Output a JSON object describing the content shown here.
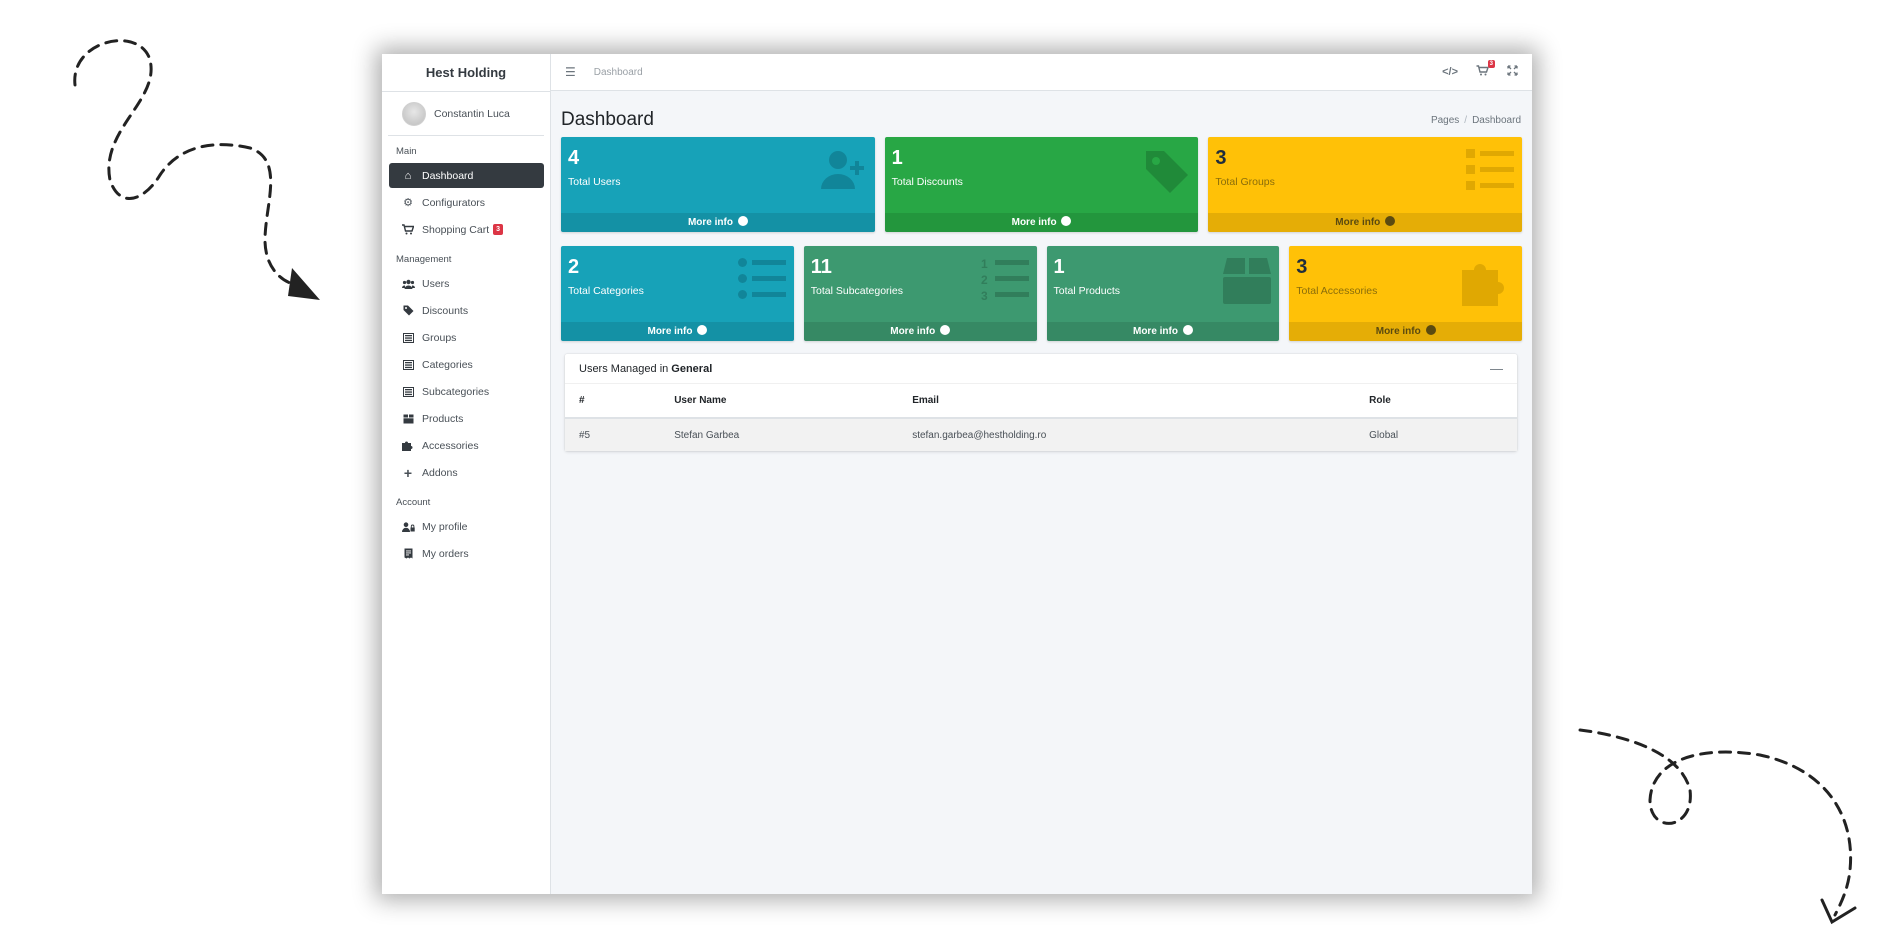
{
  "brand": "Hest Holding",
  "user": {
    "name": "Constantin Luca"
  },
  "sidebar": {
    "sections": [
      {
        "header": "Main",
        "items": [
          {
            "label": "Dashboard",
            "icon": "home-icon",
            "active": true
          },
          {
            "label": "Configurators",
            "icon": "gear-icon"
          },
          {
            "label": "Shopping Cart",
            "icon": "cart-icon",
            "badge": "3"
          }
        ]
      },
      {
        "header": "Management",
        "items": [
          {
            "label": "Users",
            "icon": "users-icon"
          },
          {
            "label": "Discounts",
            "icon": "tag-icon"
          },
          {
            "label": "Groups",
            "icon": "list-icon"
          },
          {
            "label": "Categories",
            "icon": "list-icon"
          },
          {
            "label": "Subcategories",
            "icon": "list-icon"
          },
          {
            "label": "Products",
            "icon": "box-icon"
          },
          {
            "label": "Accessories",
            "icon": "puzzle-icon"
          },
          {
            "label": "Addons",
            "icon": "plus-icon"
          }
        ]
      },
      {
        "header": "Account",
        "items": [
          {
            "label": "My profile",
            "icon": "user-lock-icon"
          },
          {
            "label": "My orders",
            "icon": "receipt-icon"
          }
        ]
      }
    ]
  },
  "topbar": {
    "link": "Dashboard",
    "cart_badge": "3"
  },
  "page": {
    "title": "Dashboard",
    "breadcrumb": [
      "Pages",
      "Dashboard"
    ]
  },
  "stats": [
    {
      "number": "4",
      "label": "Total Users",
      "color": "#17a2b8",
      "icon": "user-plus-icon",
      "footer": "More info"
    },
    {
      "number": "1",
      "label": "Total Discounts",
      "color": "#28a745",
      "icon": "tag-icon",
      "footer": "More info"
    },
    {
      "number": "3",
      "label": "Total Groups",
      "color": "#ffc107",
      "icon": "list-icon",
      "footer": "More info"
    },
    {
      "number": "2",
      "label": "Total Categories",
      "color": "#17a2b8",
      "icon": "list-ul-icon",
      "footer": "More info"
    },
    {
      "number": "11",
      "label": "Total Subcategories",
      "color": "#3d9970",
      "icon": "list-ol-icon",
      "footer": "More info"
    },
    {
      "number": "1",
      "label": "Total Products",
      "color": "#3d9970",
      "icon": "box-icon",
      "footer": "More info"
    },
    {
      "number": "3",
      "label": "Total Accessories",
      "color": "#ffc107",
      "icon": "puzzle-icon",
      "footer": "More info"
    }
  ],
  "users_card": {
    "title_prefix": "Users Managed in",
    "title_group": "General",
    "columns": [
      "#",
      "User Name",
      "Email",
      "Role"
    ],
    "rows": [
      [
        "#5",
        "Stefan Garbea",
        "stefan.garbea@hestholding.ro",
        "Global"
      ]
    ]
  }
}
